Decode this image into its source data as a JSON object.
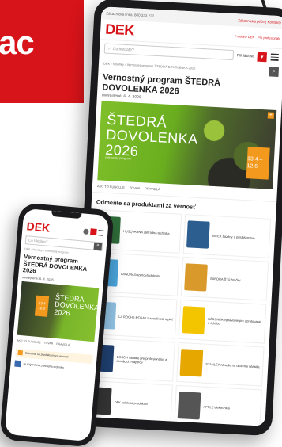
{
  "banner": {
    "text": "ac"
  },
  "tablet": {
    "topbar": {
      "left": "Zákaznická linka: 800 333 222",
      "right": "Zákaznická péče | Kontakty"
    },
    "logo": "DEK",
    "header_links": [
      "Prodejny DEK",
      "Pro profesionály"
    ],
    "search": {
      "placeholder": "Co hledáte?"
    },
    "login": "Přihlásit se",
    "breadcrumb": "DEK › Novinky › Vernostný program ŠTEDRÁ DOVOLENKA 2026",
    "page_title": "Vernostný program ŠTEDRÁ DOVOLENKA 2026",
    "date": "uverejnené: 6. 4. 2026",
    "hero": {
      "title": "ŠTEDRÁ DOVOLENKA 2026",
      "subtitle": "vernostný program",
      "badge": "13.4 – 12.6"
    },
    "tabs": [
      "AKO TO FUNGUJE",
      "TOVAR",
      "PRAVIDLÁ"
    ],
    "section_title": "Odmeňte sa produktami za vernosť",
    "products": [
      {
        "label": "HUSQVARNA záhradná technika",
        "color": "#2f6d3a"
      },
      {
        "label": "INTEX bazény a príslušenstvo",
        "color": "#2c5f8f"
      },
      {
        "label": "LAGUNA bazénová chémia",
        "color": "#4aa3d8"
      },
      {
        "label": "SANDRA ŠTÚ hračky",
        "color": "#d99a2b"
      },
      {
        "label": "LA ROCHE-POSAY starostlivosť o pleť",
        "color": "#8fbfe0"
      },
      {
        "label": "KÄRCHER vybavenie pre upratovanie a údržbu",
        "color": "#f2c500"
      },
      {
        "label": "BOSCH náradie pre profesionálov a domácich majstrov",
        "color": "#1f3f6e"
      },
      {
        "label": "STANLEY náradie na uloženie náradia",
        "color": "#e6a700"
      },
      {
        "label": "DEK kolekcia produktov",
        "color": "#333333"
      },
      {
        "label": "APPLE elektronika",
        "color": "#555555"
      }
    ]
  },
  "phone": {
    "logo": "DEK",
    "search": {
      "placeholder": "Co hledáte?"
    },
    "breadcrumb": "DEK › Novinky › Vernostný program",
    "page_title": "Vernostný program ŠTEDRÁ DOVOLENKA 2026",
    "date": "uverejnené: 6. 4. 2026",
    "hero": {
      "title": "ŠTEDRÁ DOVOLENKA 2026",
      "badge": "13.4 12.6"
    },
    "tabs": [
      "AKO TO FUNGUJE",
      "TOVAR",
      "PRAVIDLÁ"
    ],
    "banner": "Odmeňte sa produktami za vernosť",
    "item": "HUSQVARNA záhradná technika"
  }
}
